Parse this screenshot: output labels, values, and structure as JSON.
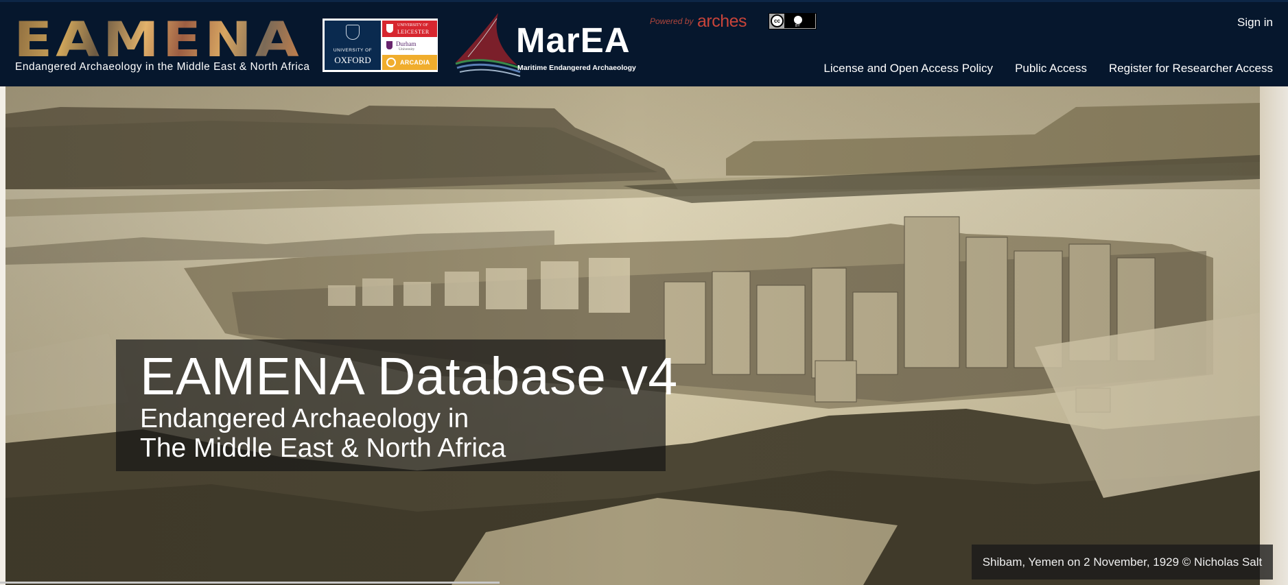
{
  "header": {
    "eamena_logo_text": "EAMENA",
    "eamena_tagline": "Endangered Archaeology in the Middle East & North Africa",
    "partners": {
      "oxford_line1": "UNIVERSITY OF",
      "oxford_line2": "OXFORD",
      "leicester_line1": "UNIVERSITY OF",
      "leicester_line2": "LEICESTER",
      "durham_line1": "Durham",
      "durham_line2": "University",
      "arcadia": "ARCADIA"
    },
    "marea_logo_text": "MarEA",
    "marea_subtitle": "Maritime Endangered Archaeology",
    "powered_by": "Powered by",
    "arches_text": "arches",
    "cc_text": "cc",
    "by_text": "BY",
    "sign_in": "Sign in",
    "nav": [
      "License and Open Access Policy",
      "Public Access",
      "Register for Researcher Access"
    ]
  },
  "hero": {
    "title": "EAMENA Database v4",
    "subtitle_line1": "Endangered Archaeology in",
    "subtitle_line2": "The Middle East & North Africa",
    "photo_credit": "Shibam, Yemen on 2 November, 1929 © Nicholas Salt"
  },
  "colors": {
    "header_bg": "#06172d",
    "arches_red": "#c8443a",
    "photo_sepia": "#cbbf9c"
  }
}
